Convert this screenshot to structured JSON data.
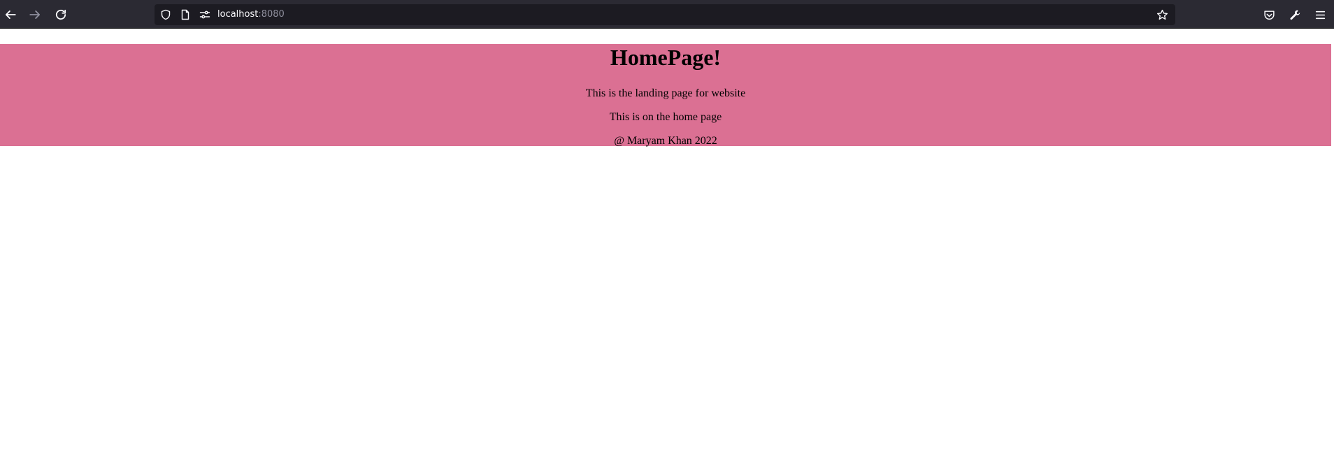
{
  "browser": {
    "url_host": "localhost",
    "url_port": ":8080",
    "icons": {
      "back": "arrow-left-icon",
      "forward": "arrow-right-icon",
      "reload": "reload-icon",
      "shield": "shield-icon",
      "page": "page-icon",
      "permissions": "permissions-icon",
      "bookmark": "star-icon",
      "pocket": "pocket-icon",
      "devtools": "wrench-icon",
      "menu": "hamburger-menu-icon"
    },
    "colors": {
      "toolbar_bg": "#2b2a33",
      "urlbar_bg": "#1c1b22"
    }
  },
  "page": {
    "heading": "HomePage!",
    "line1": "This is the landing page for website",
    "line2": "This is on the home page",
    "footer": "@ Maryam Khan 2022",
    "colors": {
      "banner_bg": "#db7093"
    }
  }
}
